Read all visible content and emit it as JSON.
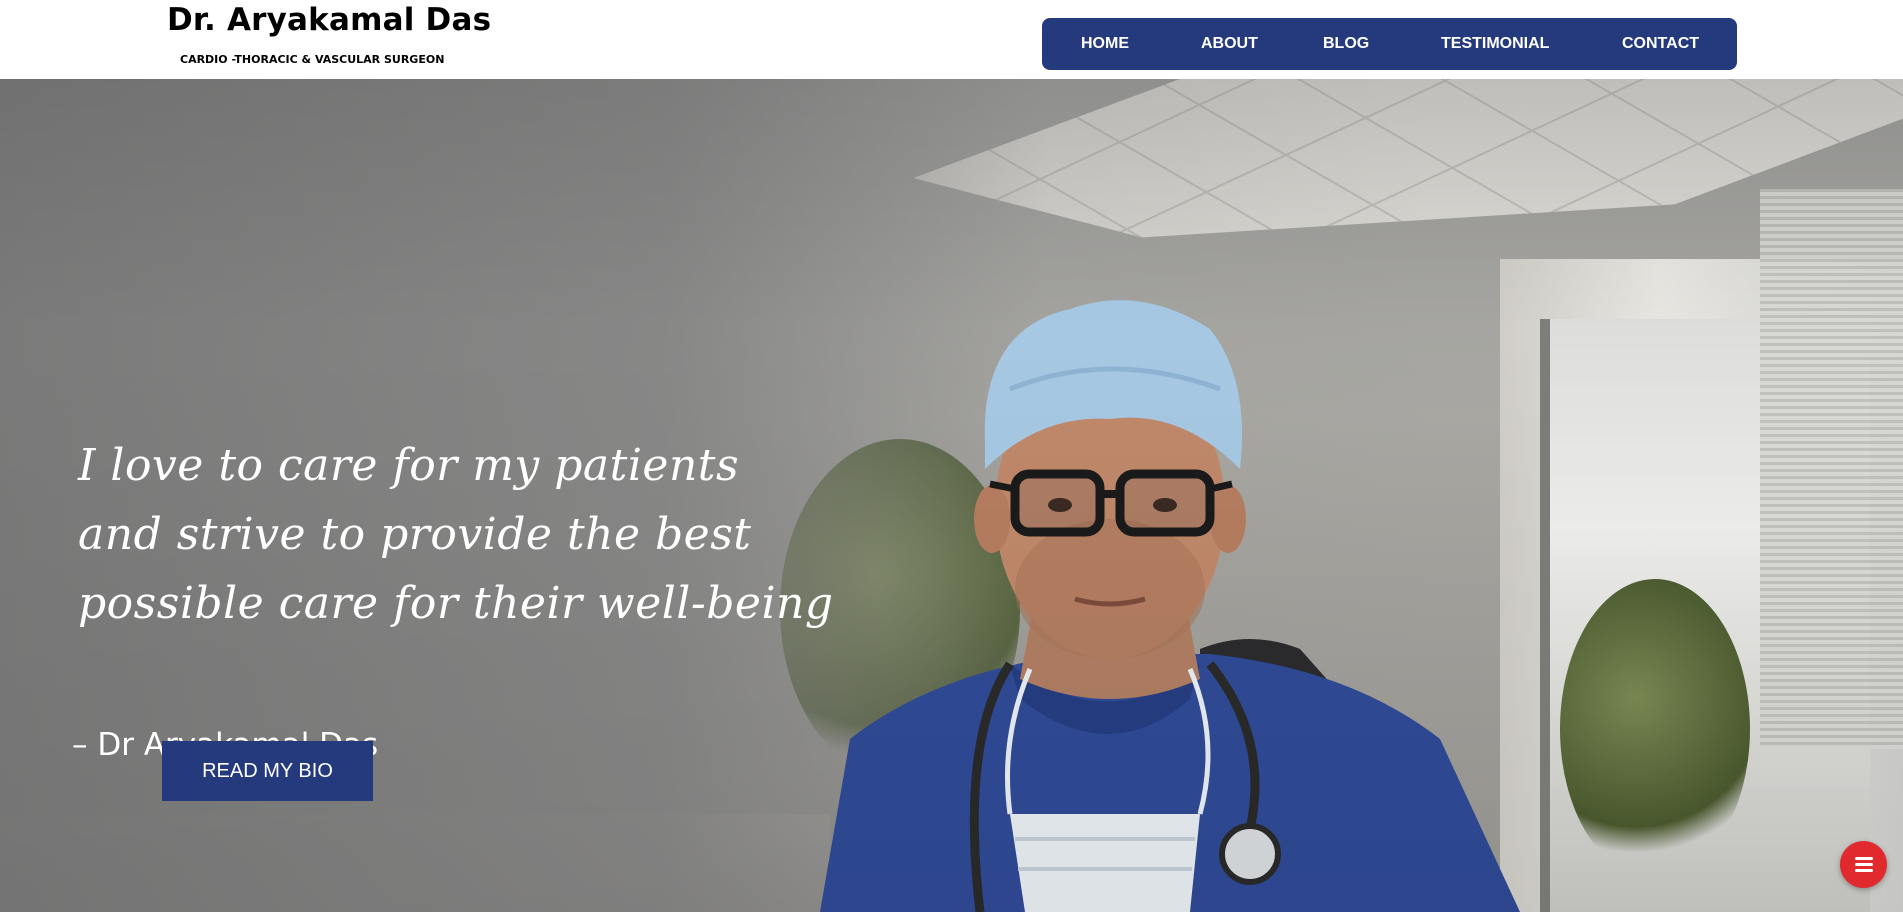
{
  "header": {
    "brand_name": "Dr. Aryakamal Das",
    "tagline": "CARDIO -THORACIC & VASCULAR SURGEON"
  },
  "nav": {
    "items": [
      {
        "label": "HOME"
      },
      {
        "label": "ABOUT"
      },
      {
        "label": "BLOG"
      },
      {
        "label": "TESTIMONIAL"
      },
      {
        "label": "CONTACT"
      }
    ]
  },
  "hero": {
    "quote_lines": [
      "I love to care for my patients",
      "and strive to provide the best",
      "possible care for their well-being"
    ],
    "attribution": "– Dr Aryakamal Das",
    "cta_label": "READ MY BIO"
  },
  "floating_menu": {
    "icon": "menu-icon"
  },
  "colors": {
    "primary": "#243a7c",
    "fab": "#e02a2e",
    "text_on_dark": "#ffffff"
  }
}
